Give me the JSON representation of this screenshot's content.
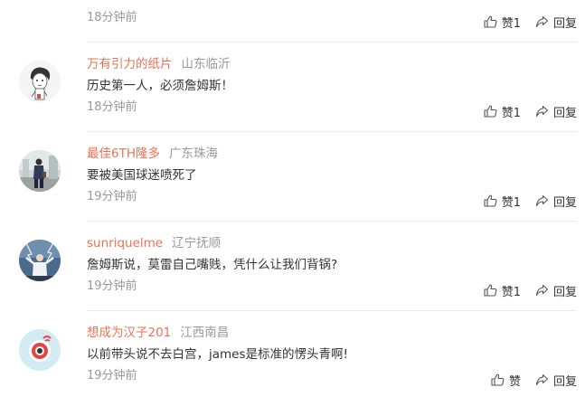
{
  "comments": [
    {
      "author": "",
      "location": "",
      "text": "",
      "time": "18分钟前",
      "like_label": "赞1",
      "reply_label": "回复",
      "avatar_icon": "none"
    },
    {
      "author": "万有引力的纸片",
      "location": "山东临沂",
      "text": "历史第一人，必须詹姆斯！",
      "time": "18分钟前",
      "like_label": "赞1",
      "reply_label": "回复",
      "avatar_icon": "sketch-girl-avatar"
    },
    {
      "author": "最佳6TH隆多",
      "location": "广东珠海",
      "text": "要被美国球迷喷死了",
      "time": "19分钟前",
      "like_label": "赞1",
      "reply_label": "回复",
      "avatar_icon": "street-photo-avatar"
    },
    {
      "author": "sunriquelme",
      "location": "辽宁抚顺",
      "text": "詹姆斯说，莫雷自己嘴贱，凭什么让我们背锅?",
      "time": "19分钟前",
      "like_label": "赞1",
      "reply_label": "回复",
      "avatar_icon": "lightning-figure-avatar"
    },
    {
      "author": "想成为汉子201",
      "location": "江西南昌",
      "text": "以前带头说不去白宫，james是标准的愣头青啊!",
      "time": "19分钟前",
      "like_label": "赞",
      "reply_label": "回复",
      "avatar_icon": "weibo-default-eye-avatar"
    }
  ],
  "colors": {
    "author": "#eb7350",
    "location": "#999999",
    "text": "#333333",
    "divider": "#ececec"
  }
}
